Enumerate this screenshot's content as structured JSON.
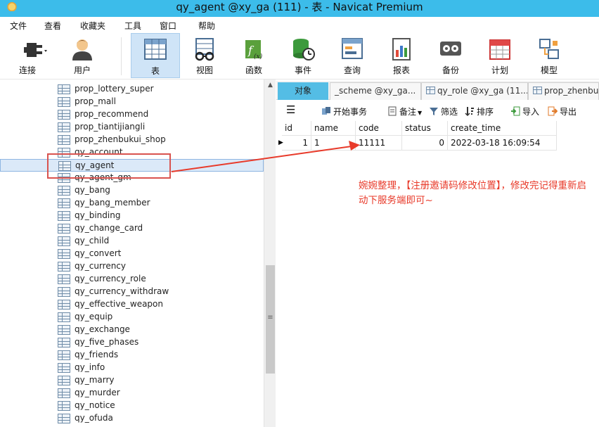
{
  "window": {
    "title": "qy_agent @xy_ga (111) - 表 - Navicat Premium"
  },
  "menu": [
    "文件",
    "查看",
    "收藏夹",
    "工具",
    "窗口",
    "帮助"
  ],
  "toolbar": {
    "connect": "连接",
    "user": "用户",
    "table": "表",
    "view": "视图",
    "function": "函数",
    "event": "事件",
    "query": "查询",
    "report": "报表",
    "backup": "备份",
    "schedule": "计划",
    "model": "模型"
  },
  "tree": {
    "items": [
      "prop_lottery_super",
      "prop_mall",
      "prop_recommend",
      "prop_tiantijiangli",
      "prop_zhenbukui_shop",
      "qy_account",
      "qy_agent",
      "qy_agent_gm",
      "qy_bang",
      "qy_bang_member",
      "qy_binding",
      "qy_change_card",
      "qy_child",
      "qy_convert",
      "qy_currency",
      "qy_currency_role",
      "qy_currency_withdraw",
      "qy_effective_weapon",
      "qy_equip",
      "qy_exchange",
      "qy_five_phases",
      "qy_friends",
      "qy_info",
      "qy_marry",
      "qy_murder",
      "qy_notice",
      "qy_ofuda"
    ],
    "selected": "qy_agent"
  },
  "tabs": {
    "objects": "对象",
    "tab2": "_scheme @xy_ga...",
    "tab3": "qy_role @xy_ga (11...",
    "tab4": "prop_zhenbu"
  },
  "subtoolbar": {
    "menu_icon": "hamburger-icon",
    "begin_transaction": "开始事务",
    "note": "备注",
    "filter": "筛选",
    "sort": "排序",
    "import": "导入",
    "export": "导出"
  },
  "grid": {
    "columns": [
      "id",
      "name",
      "code",
      "status",
      "create_time"
    ],
    "rows": [
      {
        "id": "1",
        "name": "1",
        "code": "11111",
        "status": "0",
        "create_time": "2022-03-18 16:09:54"
      }
    ]
  },
  "annotation": {
    "text": "婉婉整理，【注册邀请码修改位置】，修改完记得重新启动下服务端即可~",
    "color": "#e83a2a"
  },
  "colors": {
    "titlebar": "#3cbcea",
    "active_tab": "#54bde5",
    "selection": "#dbe9f8",
    "annotation": "#e83a2a"
  }
}
